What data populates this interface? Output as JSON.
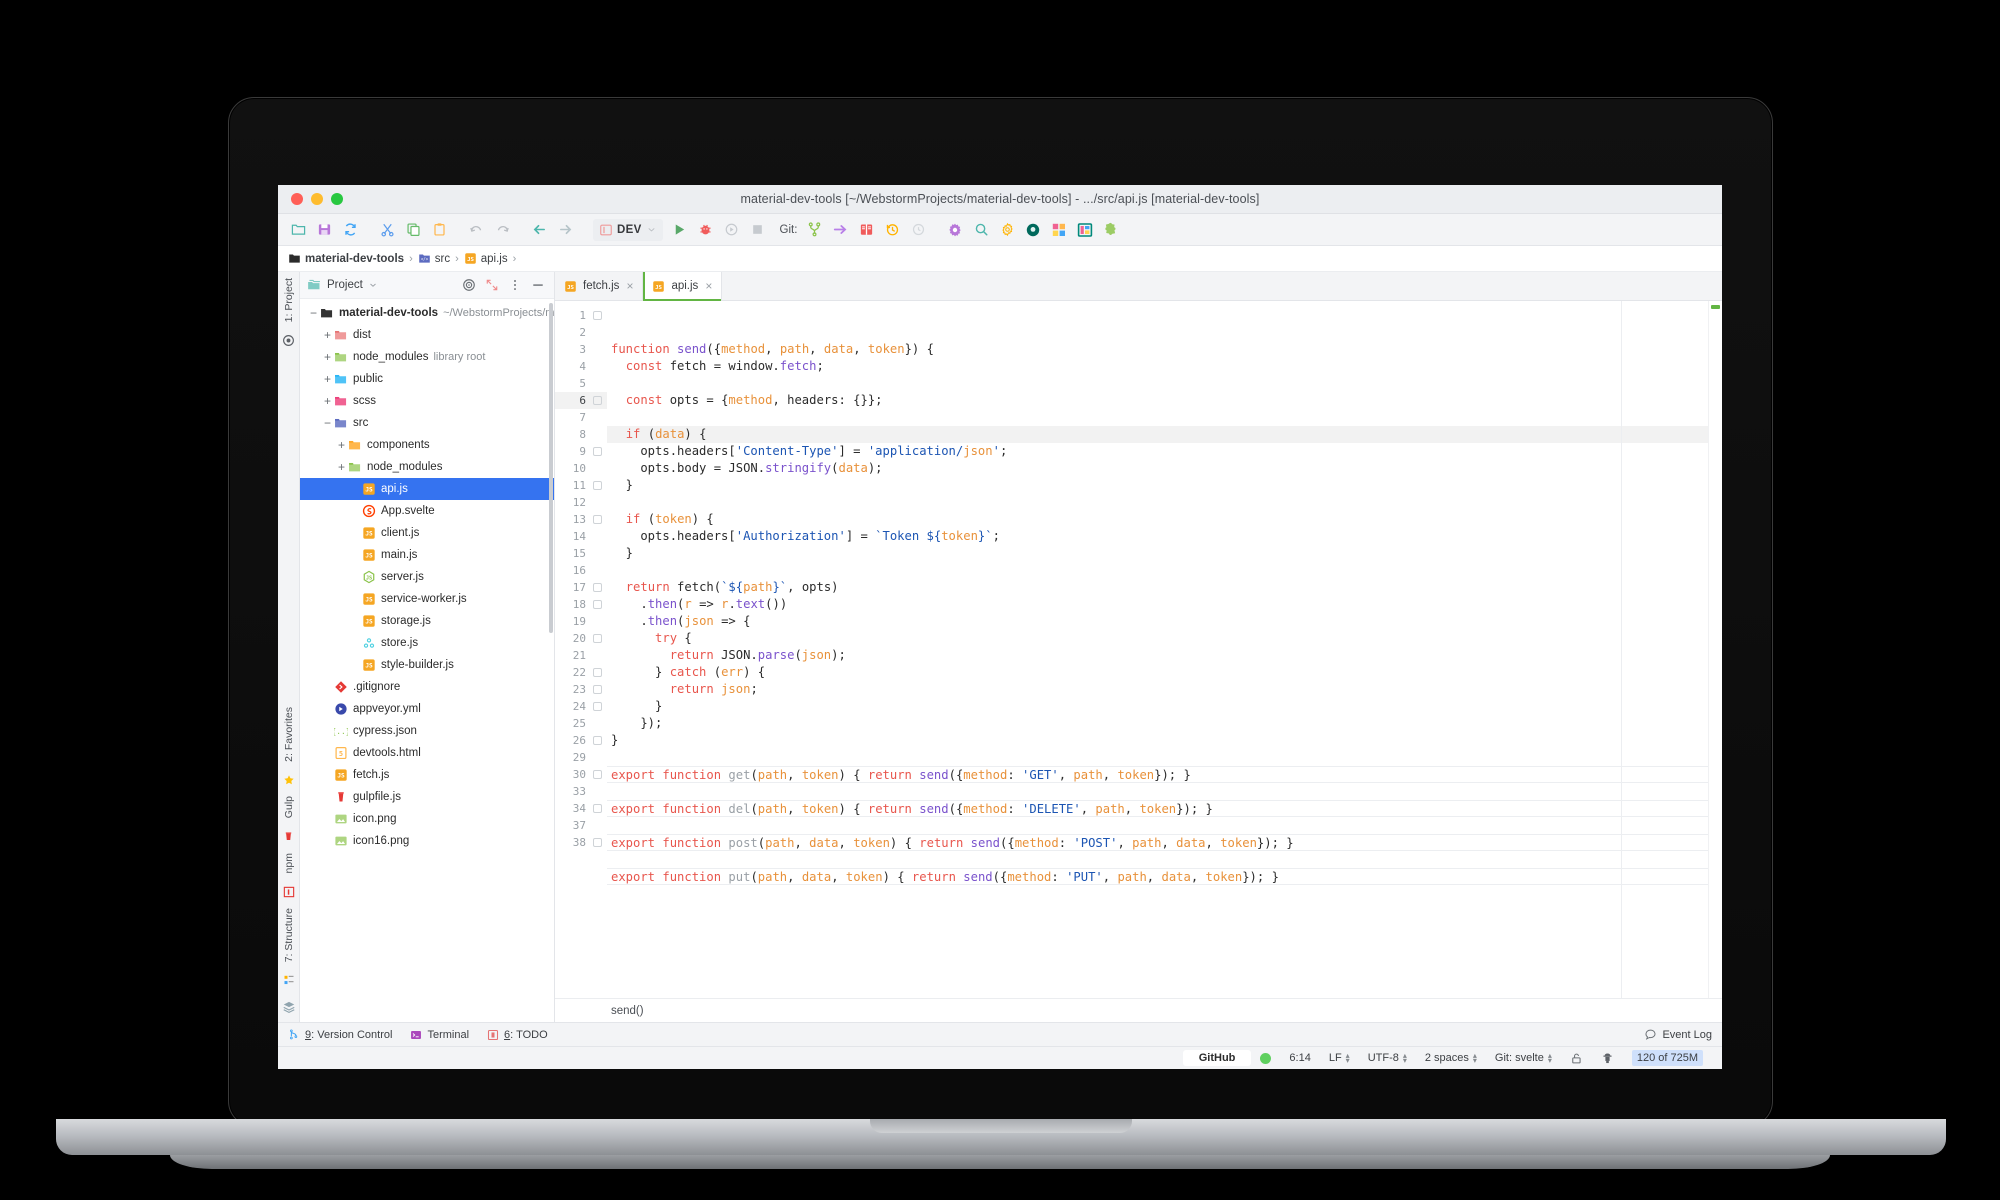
{
  "window": {
    "title": "material-dev-tools [~/WebstormProjects/material-dev-tools] - .../src/api.js [material-dev-tools]"
  },
  "toolbar": {
    "icons": [
      {
        "name": "open-folder-icon",
        "label": "Open"
      },
      {
        "name": "save-all-icon",
        "label": "Save All"
      },
      {
        "name": "sync-icon",
        "label": "Synchronize"
      },
      {
        "name": "cut-icon",
        "label": "Cut"
      },
      {
        "name": "copy-icon",
        "label": "Copy"
      },
      {
        "name": "paste-icon",
        "label": "Paste"
      },
      {
        "name": "undo-icon",
        "label": "Undo"
      },
      {
        "name": "redo-icon",
        "label": "Redo"
      },
      {
        "name": "back-arrow-icon",
        "label": "Back"
      },
      {
        "name": "forward-arrow-icon",
        "label": "Forward"
      }
    ],
    "run_config": "DEV",
    "run_label": "Run",
    "debug_label": "Debug",
    "coverage_label": "Run with Coverage",
    "stop_label": "Stop",
    "git_label": "Git:",
    "git_icons": [
      {
        "name": "git-branch-icon",
        "label": "Branches"
      },
      {
        "name": "git-push-icon",
        "label": "Push"
      },
      {
        "name": "git-update-icon",
        "label": "Update Project"
      },
      {
        "name": "git-history-icon",
        "label": "History"
      },
      {
        "name": "git-rollback-icon",
        "label": "Rollback"
      }
    ],
    "right_icons": [
      {
        "name": "settings-gear-icon",
        "label": "Settings"
      },
      {
        "name": "search-icon",
        "label": "Search Everywhere"
      },
      {
        "name": "plugin-gear-icon",
        "label": "Plugins"
      },
      {
        "name": "material-theme-icon",
        "label": "Material Theme"
      },
      {
        "name": "material-colors-icon",
        "label": "Material Colors"
      },
      {
        "name": "material-dev-tools-icon",
        "label": "Material Dev Tools"
      },
      {
        "name": "extension-puzzle-icon",
        "label": "Extensions"
      }
    ]
  },
  "breadcrumb": {
    "items": [
      {
        "label": "material-dev-tools",
        "icon": "folder-icon",
        "bold": true
      },
      {
        "label": "src",
        "icon": "src-folder-icon",
        "bold": false
      },
      {
        "label": "api.js",
        "icon": "js-file-icon",
        "bold": false
      }
    ],
    "separator": "›"
  },
  "rail": {
    "top": [
      {
        "label": "1: Project",
        "icon": "project-icon"
      }
    ],
    "bottom": [
      {
        "label": "2: Favorites",
        "icon": "star-icon"
      },
      {
        "label": "Gulp",
        "icon": "gulp-icon"
      },
      {
        "label": "npm",
        "icon": "npm-icon"
      },
      {
        "label": "7: Structure",
        "icon": "structure-icon"
      }
    ],
    "layers_icon": "layers-icon"
  },
  "project_panel": {
    "title": "Project",
    "chevron": "⌄",
    "buttons": [
      {
        "name": "scroll-from-source-icon",
        "label": "Select Opened File"
      },
      {
        "name": "collapse-all-icon",
        "label": "Collapse All"
      },
      {
        "name": "options-menu-icon",
        "label": "Options"
      },
      {
        "name": "hide-panel-icon",
        "label": "Hide"
      }
    ],
    "tree": [
      {
        "depth": 0,
        "twisty": "−",
        "icon": "folder-dark",
        "label": "material-dev-tools",
        "bold": true,
        "hint": "~/WebstormProjects/material-dev-to",
        "selected": false
      },
      {
        "depth": 1,
        "twisty": "+",
        "icon": "folder-red",
        "label": "dist",
        "bold": false,
        "hint": "",
        "selected": false
      },
      {
        "depth": 1,
        "twisty": "+",
        "icon": "folder-green",
        "label": "node_modules",
        "bold": false,
        "hint": "library root",
        "selected": false
      },
      {
        "depth": 1,
        "twisty": "+",
        "icon": "folder-blue",
        "label": "public",
        "bold": false,
        "hint": "",
        "selected": false
      },
      {
        "depth": 1,
        "twisty": "+",
        "icon": "folder-pink",
        "label": "scss",
        "bold": false,
        "hint": "",
        "selected": false
      },
      {
        "depth": 1,
        "twisty": "−",
        "icon": "folder-indigo",
        "label": "src",
        "bold": false,
        "hint": "",
        "selected": false
      },
      {
        "depth": 2,
        "twisty": "+",
        "icon": "folder-orange",
        "label": "components",
        "bold": false,
        "hint": "",
        "selected": false
      },
      {
        "depth": 2,
        "twisty": "+",
        "icon": "folder-green",
        "label": "node_modules",
        "bold": false,
        "hint": "",
        "selected": false
      },
      {
        "depth": 3,
        "twisty": "",
        "icon": "js-file",
        "label": "api.js",
        "bold": false,
        "hint": "",
        "selected": true
      },
      {
        "depth": 3,
        "twisty": "",
        "icon": "svelte-file",
        "label": "App.svelte",
        "bold": false,
        "hint": "",
        "selected": false
      },
      {
        "depth": 3,
        "twisty": "",
        "icon": "js-file",
        "label": "client.js",
        "bold": false,
        "hint": "",
        "selected": false
      },
      {
        "depth": 3,
        "twisty": "",
        "icon": "js-file",
        "label": "main.js",
        "bold": false,
        "hint": "",
        "selected": false
      },
      {
        "depth": 3,
        "twisty": "",
        "icon": "node-file",
        "label": "server.js",
        "bold": false,
        "hint": "",
        "selected": false
      },
      {
        "depth": 3,
        "twisty": "",
        "icon": "js-file",
        "label": "service-worker.js",
        "bold": false,
        "hint": "",
        "selected": false
      },
      {
        "depth": 3,
        "twisty": "",
        "icon": "js-file",
        "label": "storage.js",
        "bold": false,
        "hint": "",
        "selected": false
      },
      {
        "depth": 3,
        "twisty": "",
        "icon": "redux-file",
        "label": "store.js",
        "bold": false,
        "hint": "",
        "selected": false
      },
      {
        "depth": 3,
        "twisty": "",
        "icon": "js-file",
        "label": "style-builder.js",
        "bold": false,
        "hint": "",
        "selected": false
      },
      {
        "depth": 1,
        "twisty": "",
        "icon": "git-file",
        "label": ".gitignore",
        "bold": false,
        "hint": "",
        "selected": false
      },
      {
        "depth": 1,
        "twisty": "",
        "icon": "appveyor-file",
        "label": "appveyor.yml",
        "bold": false,
        "hint": "",
        "selected": false
      },
      {
        "depth": 1,
        "twisty": "",
        "icon": "json-file",
        "label": "cypress.json",
        "bold": false,
        "hint": "",
        "selected": false
      },
      {
        "depth": 1,
        "twisty": "",
        "icon": "html-file",
        "label": "devtools.html",
        "bold": false,
        "hint": "",
        "selected": false
      },
      {
        "depth": 1,
        "twisty": "",
        "icon": "js-file",
        "label": "fetch.js",
        "bold": false,
        "hint": "",
        "selected": false
      },
      {
        "depth": 1,
        "twisty": "",
        "icon": "gulp-file",
        "label": "gulpfile.js",
        "bold": false,
        "hint": "",
        "selected": false
      },
      {
        "depth": 1,
        "twisty": "",
        "icon": "image-file",
        "label": "icon.png",
        "bold": false,
        "hint": "",
        "selected": false
      },
      {
        "depth": 1,
        "twisty": "",
        "icon": "image-file",
        "label": "icon16.png",
        "bold": false,
        "hint": "",
        "selected": false
      }
    ]
  },
  "tabs": [
    {
      "label": "fetch.js",
      "icon": "js-file",
      "active": false,
      "close": "×"
    },
    {
      "label": "api.js",
      "icon": "js-file",
      "active": true,
      "close": "×"
    }
  ],
  "editor": {
    "line_numbers": [
      1,
      2,
      3,
      4,
      5,
      6,
      7,
      8,
      9,
      10,
      11,
      12,
      13,
      14,
      15,
      16,
      17,
      18,
      19,
      20,
      21,
      22,
      23,
      24,
      25,
      26,
      29,
      30,
      33,
      34,
      37,
      38
    ],
    "highlighted_line": 6,
    "breadcrumb": "send()",
    "lines": [
      "function send({method, path, data, token}) {",
      "  const fetch = window.fetch;",
      "",
      "  const opts = {method, headers: {}};",
      "",
      "  if (data) {",
      "    opts.headers['Content-Type'] = 'application/json';",
      "    opts.body = JSON.stringify(data);",
      "  }",
      "",
      "  if (token) {",
      "    opts.headers['Authorization'] = `Token ${token}`;",
      "  }",
      "",
      "  return fetch(`${path}`, opts)",
      "    .then(r => r.text())",
      "    .then(json => {",
      "      try {",
      "        return JSON.parse(json);",
      "      } catch (err) {",
      "        return json;",
      "      }",
      "    });",
      "}",
      "",
      "export function get(path, token) { return send({method: 'GET', path, token}); }",
      "",
      "export function del(path, token) { return send({method: 'DELETE', path, token}); }",
      "",
      "export function post(path, data, token) { return send({method: 'POST', path, data, token}); }",
      "",
      "export function put(path, data, token) { return send({method: 'PUT', path, data, token}); }"
    ]
  },
  "bottom_tools": [
    {
      "num": "9",
      "label": ": Version Control",
      "icon": "version-control-icon"
    },
    {
      "num": "",
      "label": "Terminal",
      "icon": "terminal-icon"
    },
    {
      "num": "6",
      "label": ": TODO",
      "icon": "todo-icon"
    }
  ],
  "event_log": {
    "label": "Event Log",
    "icon": "event-log-icon"
  },
  "status_bar": {
    "github": "GitHub",
    "status_dot_color": "#5fd05f",
    "caret": "6:14",
    "line_separator": "LF",
    "encoding": "UTF-8",
    "indent": "2 spaces",
    "branch": "Git: svelte",
    "lock_icon": "unlocked-icon",
    "inspector_icon": "hector-inspector-icon",
    "memory": "120 of 725M"
  },
  "colors": {
    "accent_green": "#62b543",
    "selection_blue": "#3573f0",
    "keyword_red": "#e8564d",
    "function_purple": "#7a52cc",
    "param_orange": "#e8913a",
    "string_blue": "#1c55b3"
  }
}
